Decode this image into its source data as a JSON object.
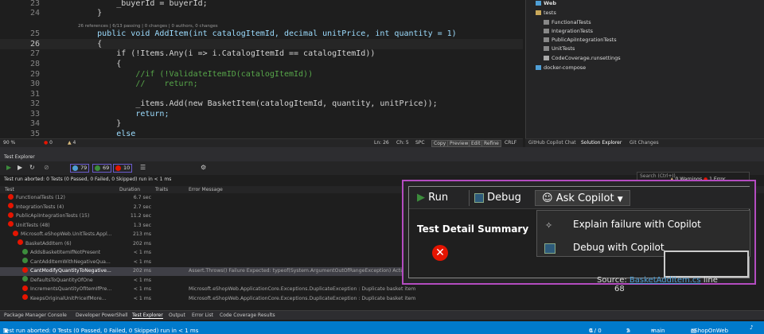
{
  "editor": {
    "lines": [
      {
        "num": "23",
        "code": "            _buyerId = buyerId;"
      },
      {
        "num": "24",
        "code": "        }"
      },
      {
        "num": "25",
        "code": "        public void AddItem(int catalogItemId, decimal unitPrice, int quantity = 1)"
      },
      {
        "num": "26",
        "code": "        {"
      },
      {
        "num": "27",
        "code": "            if (!Items.Any(i => i.CatalogItemId == catalogItemId))"
      },
      {
        "num": "28",
        "code": "            {"
      },
      {
        "num": "29",
        "code": "                //if (!ValidateItemID(catalogItemId))"
      },
      {
        "num": "30",
        "code": "                //    return;"
      },
      {
        "num": "31",
        "code": ""
      },
      {
        "num": "32",
        "code": "                _items.Add(new BasketItem(catalogItemId, quantity, unitPrice));"
      },
      {
        "num": "33",
        "code": "                return;"
      },
      {
        "num": "34",
        "code": "            }"
      },
      {
        "num": "35",
        "code": "            else"
      }
    ],
    "codelens": "26 references | 6/13 passing | 0 changes | 0 authors, 0 changes",
    "status": {
      "zoom": "90 %",
      "errors": "0",
      "warnings": "4",
      "ln": "Ln: 26",
      "ch": "Ch: 5",
      "spc": "SPC",
      "copy": "Copy",
      "preview": "Preview",
      "edit": "Edit",
      "refine": "Refine",
      "crlf": "CRLF"
    }
  },
  "solution": {
    "items": [
      {
        "label": "Web",
        "bold": true
      },
      {
        "label": "tests"
      },
      {
        "label": "FunctionalTests"
      },
      {
        "label": "IntegrationTests"
      },
      {
        "label": "PublicApiIntegrationTests"
      },
      {
        "label": "UnitTests"
      },
      {
        "label": "CodeCoverage.runsettings"
      },
      {
        "label": "docker-compose"
      }
    ],
    "tabs": [
      "GitHub Copilot Chat",
      "Solution Explorer",
      "Git Changes"
    ]
  },
  "test_explorer": {
    "title": "Test Explorer",
    "counts": {
      "total": "79",
      "passed": "69",
      "failed": "10"
    },
    "search_placeholder": "Search (Ctrl+I)",
    "summary": "Test run aborted: 0 Tests (0 Passed, 0 Failed, 0 Skipped) run in < 1 ms",
    "warnings": "0 Warnings",
    "errors": "1 Error",
    "columns": [
      "Test",
      "Duration",
      "Traits",
      "Error Message"
    ],
    "rows": [
      {
        "name": "FunctionalTests (12)",
        "status": "fail",
        "indent": 1,
        "duration": "6.7 sec",
        "error": ""
      },
      {
        "name": "IntegrationTests (4)",
        "status": "fail",
        "indent": 1,
        "duration": "2.7 sec",
        "error": ""
      },
      {
        "name": "PublicApiIntegrationTests (15)",
        "status": "fail",
        "indent": 1,
        "duration": "11.2 sec",
        "error": ""
      },
      {
        "name": "UnitTests (48)",
        "status": "fail",
        "indent": 1,
        "duration": "1.3 sec",
        "error": ""
      },
      {
        "name": "Microsoft.eShopWeb.UnitTests.Appl...",
        "status": "fail",
        "indent": 2,
        "duration": "213 ms",
        "error": ""
      },
      {
        "name": "BasketAddItem (6)",
        "status": "fail",
        "indent": 3,
        "duration": "202 ms",
        "error": ""
      },
      {
        "name": "AddsBasketItemIfNotPresent",
        "status": "pass",
        "indent": 4,
        "duration": "< 1 ms",
        "error": ""
      },
      {
        "name": "CantAddItemWithNegativeQua...",
        "status": "pass",
        "indent": 4,
        "duration": "< 1 ms",
        "error": ""
      },
      {
        "name": "CantModifyQuantityToNegative...",
        "status": "fail",
        "indent": 4,
        "duration": "202 ms",
        "error": "Assert.Throws() Failure Expected: typeof(System.ArgumentOutOfRangeException) Actual:",
        "sel": true
      },
      {
        "name": "DefaultsToQuantityOfOne",
        "status": "pass",
        "indent": 4,
        "duration": "< 1 ms",
        "error": ""
      },
      {
        "name": "IncrementsQuantityOfItemIfPre...",
        "status": "fail",
        "indent": 4,
        "duration": "< 1 ms",
        "error": "Microsoft.eShopWeb.ApplicationCore.Exceptions.DuplicateException : Duplicate basket item"
      },
      {
        "name": "KeepsOriginalUnitPriceIfMore...",
        "status": "fail",
        "indent": 4,
        "duration": "< 1 ms",
        "error": "Microsoft.eShopWeb.ApplicationCore.Exceptions.DuplicateException : Duplicate basket item"
      }
    ]
  },
  "detail": {
    "run": "Run",
    "debug": "Debug",
    "ask_copilot": "Ask Copilot",
    "title": "Test Detail Summary",
    "menu": [
      "Explain failure with Copilot",
      "Debug with Copilot"
    ],
    "source_label": "Source:",
    "source_link": "BasketAddItem.cs",
    "source_line": "line",
    "source_num": "68"
  },
  "bottom_tabs": [
    "Package Manager Console",
    "Developer PowerShell",
    "Test Explorer",
    "Output",
    "Error List",
    "Code Coverage Results"
  ],
  "status_bar": {
    "left": "Test run aborted: 0 Tests (0 Passed, 0 Failed, 0 Skipped) run in < 1 ms",
    "sync": "0 / 0",
    "pencil": "2",
    "branch": "main",
    "repo": "eShopOnWeb"
  }
}
